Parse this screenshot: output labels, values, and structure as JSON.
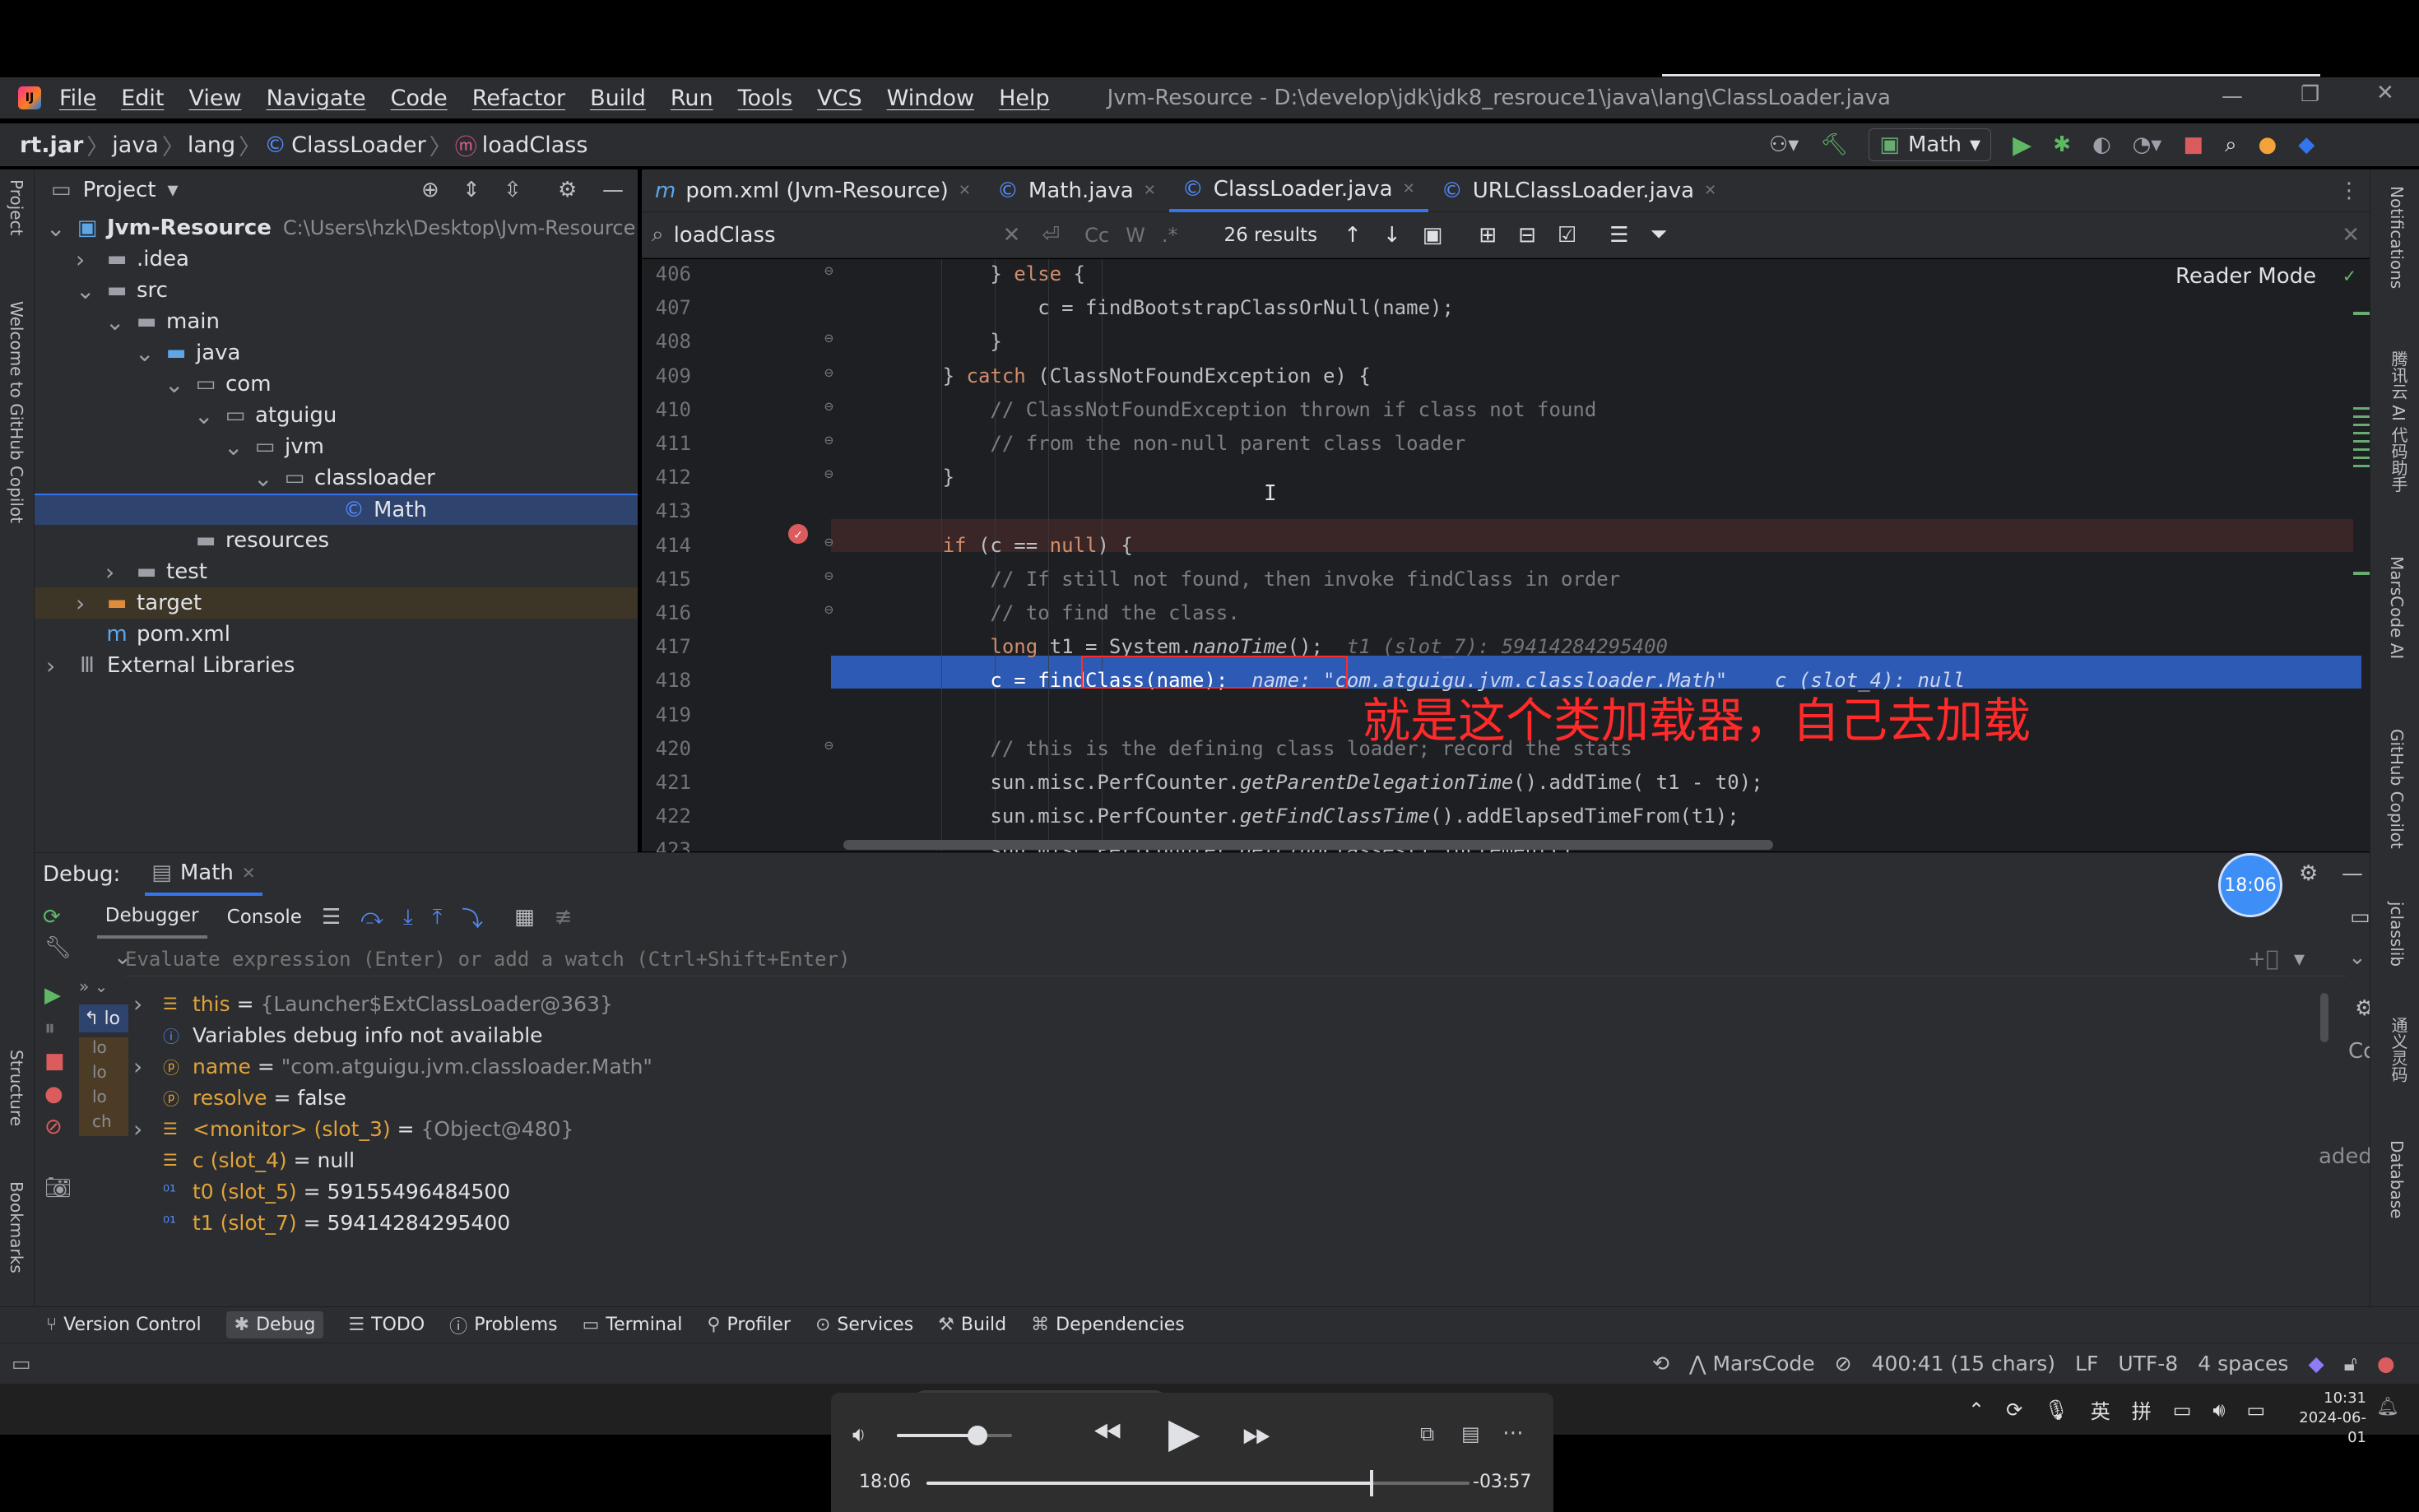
{
  "app": {
    "title": "Jvm-Resource - D:\\develop\\jdk\\jdk8_resrouce1\\java\\lang\\ClassLoader.java",
    "menu": [
      "File",
      "Edit",
      "View",
      "Navigate",
      "Code",
      "Refactor",
      "Build",
      "Run",
      "Tools",
      "VCS",
      "Window",
      "Help"
    ]
  },
  "breadcrumb": [
    "rt.jar",
    "java",
    "lang",
    "ClassLoader",
    "loadClass"
  ],
  "run_config": "Math",
  "tabs": [
    "pom.xml (Jvm-Resource)",
    "Math.java",
    "ClassLoader.java",
    "URLClassLoader.java"
  ],
  "find": {
    "query": "loadClass",
    "case_label": "Cc",
    "word_label": "W",
    "regex_label": ".*",
    "results": "26 results"
  },
  "reader_mode": "Reader Mode",
  "project": {
    "header": "Project",
    "tree": [
      {
        "label": "Jvm-Resource",
        "path": "C:\\Users\\hzk\\Desktop\\Jvm-Resource",
        "arrow": "v",
        "icon": "module-icon"
      },
      {
        "label": ".idea",
        "arrow": ">",
        "icon": "folder-icon"
      },
      {
        "label": "src",
        "arrow": "v",
        "icon": "folder-icon"
      },
      {
        "label": "main",
        "arrow": "v",
        "icon": "folder-icon"
      },
      {
        "label": "java",
        "arrow": "v",
        "icon": "source-folder-icon"
      },
      {
        "label": "com",
        "arrow": "v",
        "icon": "package-icon"
      },
      {
        "label": "atguigu",
        "arrow": "v",
        "icon": "package-icon"
      },
      {
        "label": "jvm",
        "arrow": "v",
        "icon": "package-icon"
      },
      {
        "label": "classloader",
        "arrow": "v",
        "icon": "package-icon"
      },
      {
        "label": "Math",
        "arrow": "",
        "icon": "class-icon",
        "selected": true
      },
      {
        "label": "resources",
        "arrow": "",
        "icon": "resources-folder-icon"
      },
      {
        "label": "test",
        "arrow": ">",
        "icon": "folder-icon"
      },
      {
        "label": "target",
        "arrow": ">",
        "icon": "excluded-folder-icon",
        "highlight": true
      },
      {
        "label": "pom.xml",
        "arrow": "",
        "icon": "maven-icon"
      },
      {
        "label": "External Libraries",
        "arrow": ">",
        "icon": "library-icon"
      }
    ]
  },
  "code": [
    {
      "n": "406",
      "html": "            } <span class='kw'>else</span> {"
    },
    {
      "n": "407",
      "html": "                c = findBootstrapClassOrNull(name);"
    },
    {
      "n": "408",
      "html": "            }"
    },
    {
      "n": "409",
      "html": "        } <span class='kw'>catch</span> (ClassNotFoundException e) {"
    },
    {
      "n": "410",
      "html": "            <span class='cm'>// ClassNotFoundException thrown if class not found</span>"
    },
    {
      "n": "411",
      "html": "            <span class='cm'>// from the non-null parent class loader</span>"
    },
    {
      "n": "412",
      "html": "        }"
    },
    {
      "n": "413",
      "html": ""
    },
    {
      "n": "414",
      "html": "        <span class='kw'>if</span> (c == <span class='kw'>null</span>) {"
    },
    {
      "n": "415",
      "html": "            <span class='cm'>// If still not found, then invoke findClass in order</span>"
    },
    {
      "n": "416",
      "html": "            <span class='cm'>// to find the class.</span>"
    },
    {
      "n": "417",
      "html": "            <span class='kw'>long</span> t1 = System.<span class='it'>nanoTime</span>();  <span class='hint'>t1 (slot_7): 59414284295400</span>"
    },
    {
      "n": "418",
      "html": "            c = findClass(name);  <span class='hint' style='color:#c9d4f0'>name: \"com.atguigu.jvm.classloader.Math\"    c (slot_4): null</span>"
    },
    {
      "n": "419",
      "html": ""
    },
    {
      "n": "420",
      "html": "            <span class='cm'>// this is the defining class loader; record the stats</span>"
    },
    {
      "n": "421",
      "html": "            sun.misc.PerfCounter.<span class='it'>getParentDelegationTime</span>().addTime( t1 - t0);"
    },
    {
      "n": "422",
      "html": "            sun.misc.PerfCounter.<span class='it'>getFindClassTime</span>().addElapsedTimeFrom(t1);"
    },
    {
      "n": "423",
      "html": "            sun.misc.PerfCounter.<span class='it'>getFindClasses</span>().increment();"
    }
  ],
  "annotation": "就是这个类加载器，自己去加载",
  "debug": {
    "label": "Debug:",
    "session": "Math",
    "tabs": [
      "Debugger",
      "Console"
    ],
    "eval_placeholder": "Evaluate expression (Enter) or add a watch (Ctrl+Shift+Enter)",
    "frame_label": "lo",
    "right_hint": "aded.",
    "right_co": "Co",
    "time_badge": "18:06",
    "vars": [
      {
        "arrow": ">",
        "icon": "field-icon",
        "name": "this",
        "sep": " = ",
        "value": "{Launcher$ExtClassLoader@363}",
        "vclass": "gray"
      },
      {
        "arrow": "",
        "icon": "info-icon",
        "name": "Variables debug info not available",
        "sep": "",
        "value": "",
        "vclass": ""
      },
      {
        "arrow": ">",
        "icon": "param-icon",
        "name": "name",
        "sep": " = ",
        "value": "\"com.atguigu.jvm.classloader.Math\"",
        "vclass": "gray"
      },
      {
        "arrow": "",
        "icon": "param-icon",
        "name": "resolve",
        "sep": " = ",
        "value": "false",
        "vclass": ""
      },
      {
        "arrow": ">",
        "icon": "field-icon",
        "name": "<monitor> (slot_3)",
        "sep": " = ",
        "value": "{Object@480}",
        "vclass": "gray"
      },
      {
        "arrow": "",
        "icon": "field-icon",
        "name": "c (slot_4)",
        "sep": " = ",
        "value": "null",
        "vclass": ""
      },
      {
        "arrow": "",
        "icon": "primitive-icon",
        "name": "t0 (slot_5)",
        "sep": " = ",
        "value": "59155496484500",
        "vclass": ""
      },
      {
        "arrow": "",
        "icon": "primitive-icon",
        "name": "t1 (slot_7)",
        "sep": " = ",
        "value": "59414284295400",
        "vclass": ""
      }
    ]
  },
  "toolwindows": [
    "Version Control",
    "Debug",
    "TODO",
    "Problems",
    "Terminal",
    "Profiler",
    "Services",
    "Build",
    "Dependencies"
  ],
  "left_strip": [
    "Project",
    "Welcome to GitHub Copilot",
    "Structure",
    "Bookmarks"
  ],
  "right_strip": [
    "Notifications",
    "腾讯云 AI 代码助手",
    "MarsCode AI",
    "GitHub Copilot",
    "jclasslib",
    "通义灵码",
    "Database"
  ],
  "status": {
    "marscode": "MarsCode",
    "position": "400:41 (15 chars)",
    "line_sep": "LF",
    "encoding": "UTF-8",
    "indent": "4 spaces"
  },
  "taskbar": {
    "ime1": "英",
    "ime2": "拼",
    "time": "10:31",
    "date": "2024-06-01"
  },
  "player": {
    "elapsed": "18:06",
    "remaining": "-03:57",
    "progress": 0.82,
    "volume": 0.7
  },
  "colors": {
    "accent": "#3574f0",
    "annotation": "#ff2a2a",
    "breakpoint_line": "#3a2626",
    "selected_line": "#2d5ab4"
  }
}
